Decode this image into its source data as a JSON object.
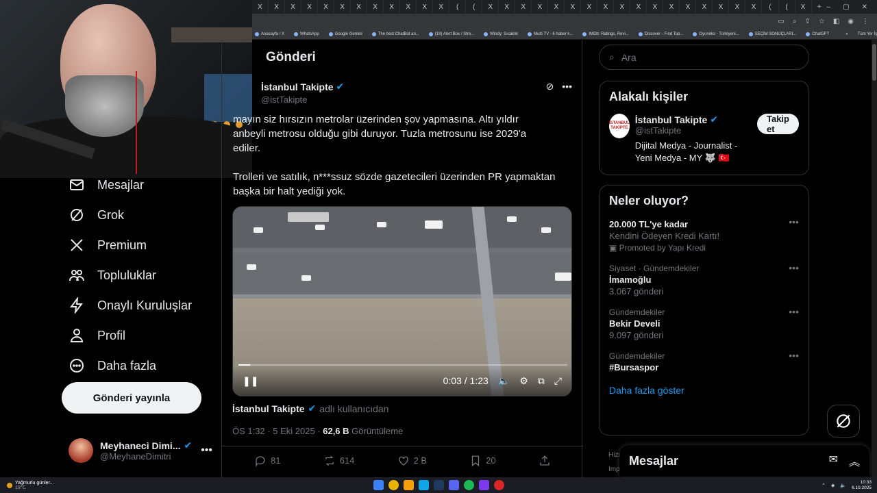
{
  "browser": {
    "tab_labels": [
      "X",
      "X",
      "X",
      "X",
      "X",
      "X",
      "X",
      "X",
      "X",
      "X",
      "X",
      "X",
      "(",
      "(",
      "X",
      "X",
      "X",
      "X",
      "X",
      "X",
      "X",
      "X",
      "X",
      "X",
      "X",
      "X",
      "X",
      "X",
      "X",
      "X",
      "X",
      "(",
      "(",
      "X"
    ],
    "window_controls": [
      "–",
      "▢",
      "✕"
    ],
    "new_tab": "+",
    "bookmarks": [
      "Anasayfa / X",
      "WhatsApp",
      "Google Gemini",
      "The best ChatBot an...",
      "(19) Alert Box / Stre...",
      "Windy: Sıcaklık",
      "Multi TV - 6 haber k...",
      "IMDb: Ratings, Revi...",
      "Discover - Find Top...",
      "Oyuneks - Türkiyeni...",
      "SEÇİM SONUÇLARI...",
      "ChatGPT"
    ],
    "bookmarks_overflow": "»",
    "all_bookmarks": "Tüm Yer İşaretleri"
  },
  "sidebar": {
    "items": [
      {
        "label": "Mesajlar",
        "icon": "envelope-icon"
      },
      {
        "label": "Grok",
        "icon": "grok-icon"
      },
      {
        "label": "Premium",
        "icon": "x-logo-icon"
      },
      {
        "label": "Topluluklar",
        "icon": "communities-icon"
      },
      {
        "label": "Onaylı Kuruluşlar",
        "icon": "lightning-icon"
      },
      {
        "label": "Profil",
        "icon": "person-icon"
      },
      {
        "label": "Daha fazla",
        "icon": "more-circle-icon"
      }
    ],
    "post_button": "Gönderi yayınla",
    "profile": {
      "name": "Meyhaneci Dimi...",
      "handle": "@MeyhaneDimitri",
      "more": "•••"
    }
  },
  "main": {
    "title": "Gönderi",
    "author": {
      "name": "İstanbul Takipte",
      "handle": "@istTakipte"
    },
    "more": "•••",
    "text": "mayın siz hırsızın metrolar üzerinden şov yapmasına. Altı yıldır\nanbeyli metrosu olduğu gibi duruyor. Tuzla metrosunu ise 2029'a\n ediler.\n\nTrolleri ve satılık, n***ssuz sözde gazetecileri üzerinden PR yapmaktan\nbaşka bir halt yediği yok.",
    "video": {
      "time": "0:03 / 1:23",
      "progress": 0.036
    },
    "attribution": {
      "name": "İstanbul Takipte",
      "suffix": "adlı kullanıcıdan"
    },
    "meta": {
      "time": "ÖS 1:32 · 5 Eki 2025 · ",
      "views": "62,6 B",
      "views_label": " Görüntüleme"
    },
    "actions": {
      "replies": "81",
      "reposts": "614",
      "likes": "2 B",
      "bookmarks": "20"
    }
  },
  "right": {
    "search_placeholder": "Ara",
    "related": {
      "title": "Alakalı kişiler",
      "name": "İstanbul Takipte",
      "handle": "@istTakipte",
      "bio": "Dijital Medya - Journalist - Yeni Medya - MY 🐺 🇹🇷",
      "follow": "Takip et",
      "avatar_text": "İSTANBUL TAKİPTE"
    },
    "trends": {
      "title": "Neler oluyor?",
      "items": [
        {
          "context": "",
          "title": "20.000 TL'ye kadar",
          "sub": "Kendini Ödeyen Kredi Kartı!",
          "promo": "Promoted by Yapı Kredi"
        },
        {
          "context": "Siyaset · Gündemdekiler",
          "title": "İmamoğlu",
          "sub": "3.067 gönderi"
        },
        {
          "context": "Gündemdekiler",
          "title": "Bekir Develi",
          "sub": "9.097 gönderi"
        },
        {
          "context": "Gündemdekiler",
          "title": "#Bursaspor",
          "sub": ""
        }
      ],
      "show_more": "Daha fazla göster"
    },
    "stub_lines": [
      "Hizm",
      "Impr"
    ],
    "messages": "Mesajlar"
  },
  "taskbar": {
    "weather_title": "Yağmurlu günler...",
    "weather_temp": "19°C",
    "time": "10:33",
    "date": "6.10.2025"
  }
}
